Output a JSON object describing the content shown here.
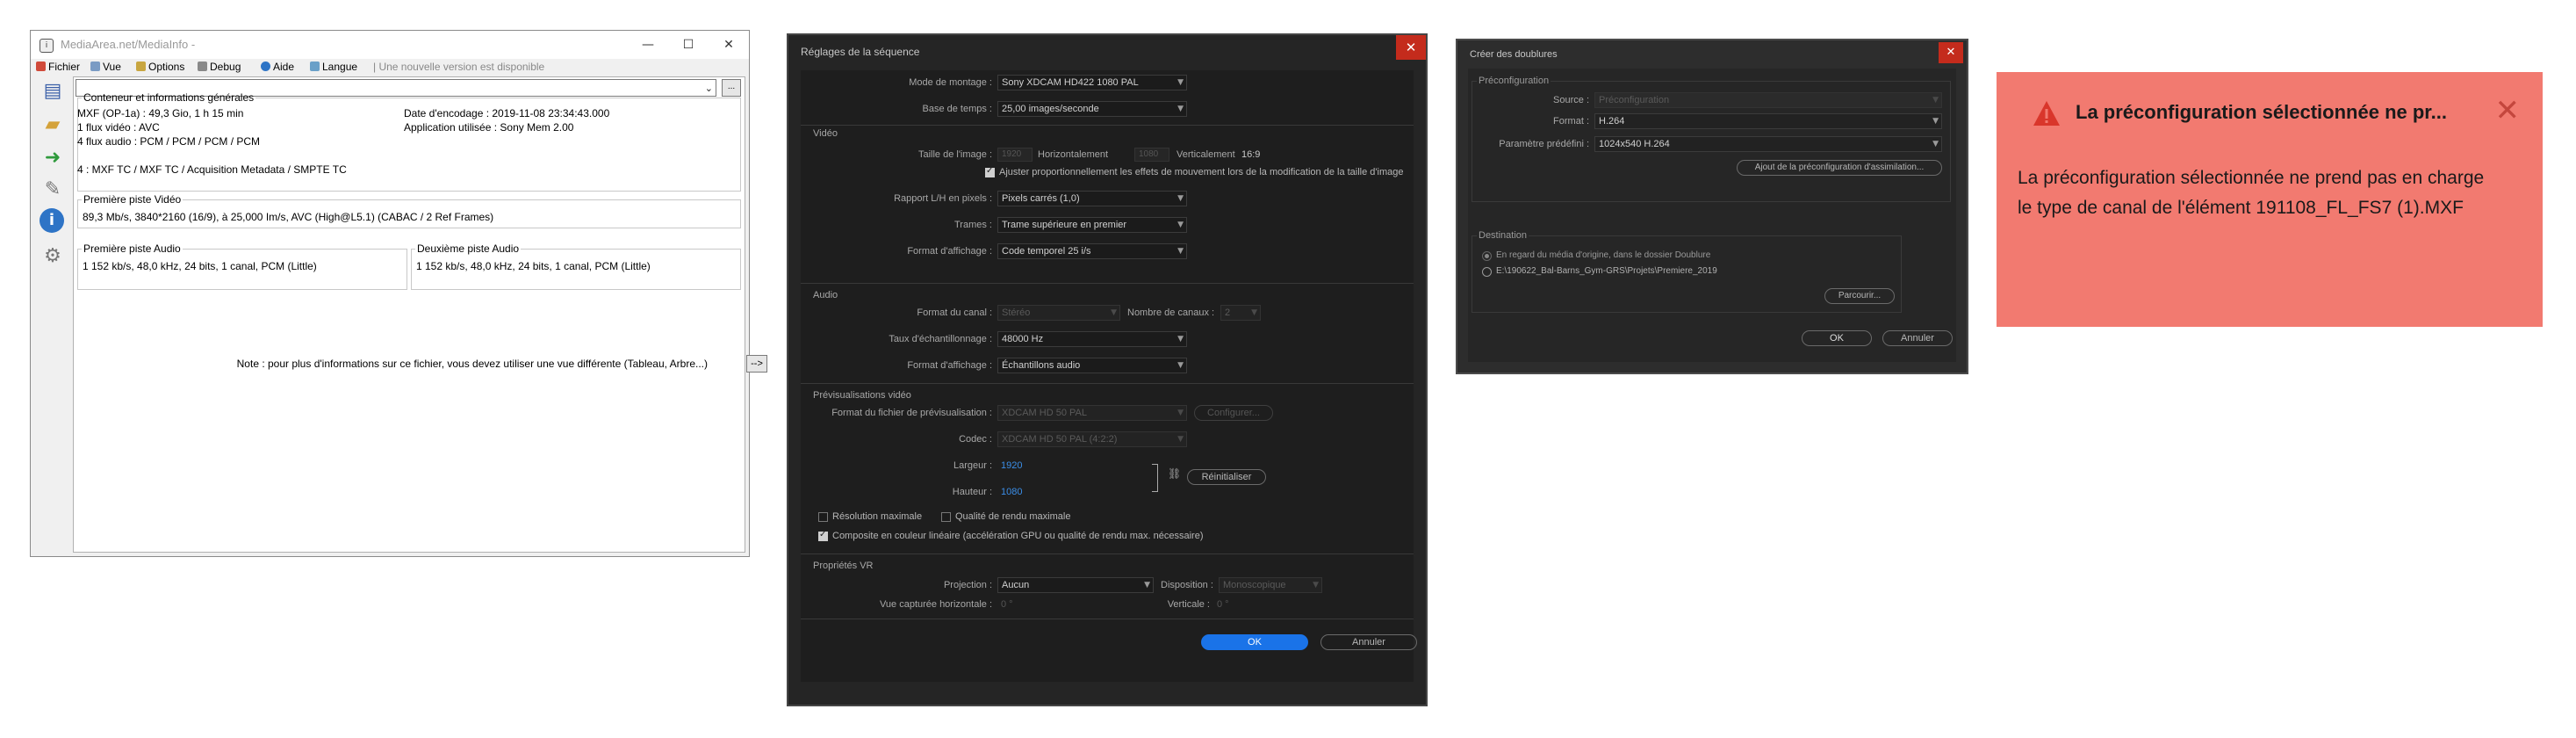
{
  "mediainfo": {
    "title": "MediaArea.net/MediaInfo - ",
    "window_controls": {
      "minimize": "—",
      "maximize": "☐",
      "close": "✕"
    },
    "menu": [
      "Fichier",
      "Vue",
      "Options",
      "Debug",
      "Aide",
      "Langue"
    ],
    "update_notice": "| Une nouvelle version est disponible",
    "combo_button": "...",
    "general": {
      "legend": "Conteneur et informations générales",
      "left": [
        "MXF (OP-1a) : 49,3 Gio, 1 h 15 min",
        "1 flux vidéo : AVC",
        "4 flux audio : PCM / PCM / PCM / PCM",
        "",
        "4 : MXF TC / MXF TC / Acquisition Metadata / SMPTE TC"
      ],
      "right": [
        "Date d'encodage : 2019-11-08 23:34:43.000",
        "Application utilisée : Sony Mem 2.00"
      ]
    },
    "video": {
      "legend": "Première piste Vidéo",
      "text": "89,3 Mb/s, 3840*2160 (16/9), à 25,000 Im/s, AVC (High@L5.1) (CABAC / 2 Ref Frames)"
    },
    "audio1": {
      "legend": "Première piste Audio",
      "text": "1 152 kb/s, 48,0 kHz, 24 bits, 1 canal, PCM (Little)"
    },
    "audio2": {
      "legend": "Deuxième piste Audio",
      "text": "1 152 kb/s, 48,0 kHz, 24 bits, 1 canal, PCM (Little)"
    },
    "note": "Note : pour plus d'informations sur ce fichier, vous devez utiliser une vue différente (Tableau, Arbre...)",
    "note_button": "-->"
  },
  "sequence": {
    "title": "Réglages de la séquence",
    "close": "✕",
    "editing_mode_label": "Mode de montage :",
    "editing_mode": "Sony XDCAM HD422 1080 PAL",
    "timebase_label": "Base de temps :",
    "timebase": "25,00  images/seconde",
    "video_section": "Vidéo",
    "frame_size_label": "Taille de l'image :",
    "frame_width": "1920",
    "horizontal_label": "Horizontalement",
    "frame_height": "1080",
    "vertical_label": "Verticalement",
    "aspect": "16:9",
    "scale_motion_label": "Ajuster proportionnellement les effets de mouvement lors de la modification de la taille d'image",
    "pixel_aspect_label": "Rapport L/H en pixels :",
    "pixel_aspect": "Pixels carrés (1,0)",
    "fields_label": "Trames :",
    "fields": "Trame supérieure en premier",
    "display_format_label": "Format d'affichage :",
    "display_format": "Code temporel 25 i/s",
    "audio_section": "Audio",
    "channel_format_label": "Format du canal :",
    "channel_format": "Stéréo",
    "channel_count_label": "Nombre de canaux :",
    "channel_count": "2",
    "sample_rate_label": "Taux d'échantillonnage :",
    "sample_rate": "48000 Hz",
    "audio_display_label": "Format d'affichage :",
    "audio_display": "Échantillons audio",
    "preview_section": "Prévisualisations vidéo",
    "preview_format_label": "Format du fichier de prévisualisation :",
    "preview_format": "XDCAM HD 50 PAL",
    "configure": "Configurer...",
    "codec_label": "Codec :",
    "codec": "XDCAM HD 50 PAL (4:2:2)",
    "width_label": "Largeur :",
    "width": "1920",
    "height_label": "Hauteur :",
    "height": "1080",
    "reset": "Réinitialiser",
    "max_res_label": "Résolution maximale",
    "max_quality_label": "Qualité de rendu maximale",
    "linear_label": "Composite en couleur linéaire (accélération GPU ou qualité de rendu max. nécessaire)",
    "vr_section": "Propriétés VR",
    "projection_label": "Projection :",
    "projection": "Aucun",
    "layout_label": "Disposition :",
    "layout": "Monoscopique",
    "h_fov_label": "Vue capturée horizontale :",
    "h_fov": "0 °",
    "v_fov_label": "Verticale :",
    "v_fov": "0 °",
    "ok": "OK",
    "cancel": "Annuler"
  },
  "proxy": {
    "title": "Créer des doublures",
    "close": "✕",
    "preset_group": "Préconfiguration",
    "source_label": "Source :",
    "source": "Préconfiguration",
    "format_label": "Format :",
    "format": "H.264",
    "preset_label": "Paramètre prédéfini :",
    "preset": "1024x540 H.264",
    "add_preset": "Ajout de la préconfiguration d'assimilation...",
    "destination_group": "Destination",
    "dest_option1": "En regard du média d'origine, dans le dossier Doublure",
    "dest_option2": "E:\\190622_Bal-Barns_Gym-GRS\\Projets\\Premiere_2019",
    "browse": "Parcourir...",
    "ok": "OK",
    "cancel": "Annuler"
  },
  "error": {
    "title": "La préconfiguration sélectionnée ne pr...",
    "close": "✕",
    "message": "La préconfiguration sélectionnée ne prend pas en charge le type de canal de l'élément 191108_FL_FS7 (1).MXF",
    "icon": "warning-icon"
  }
}
